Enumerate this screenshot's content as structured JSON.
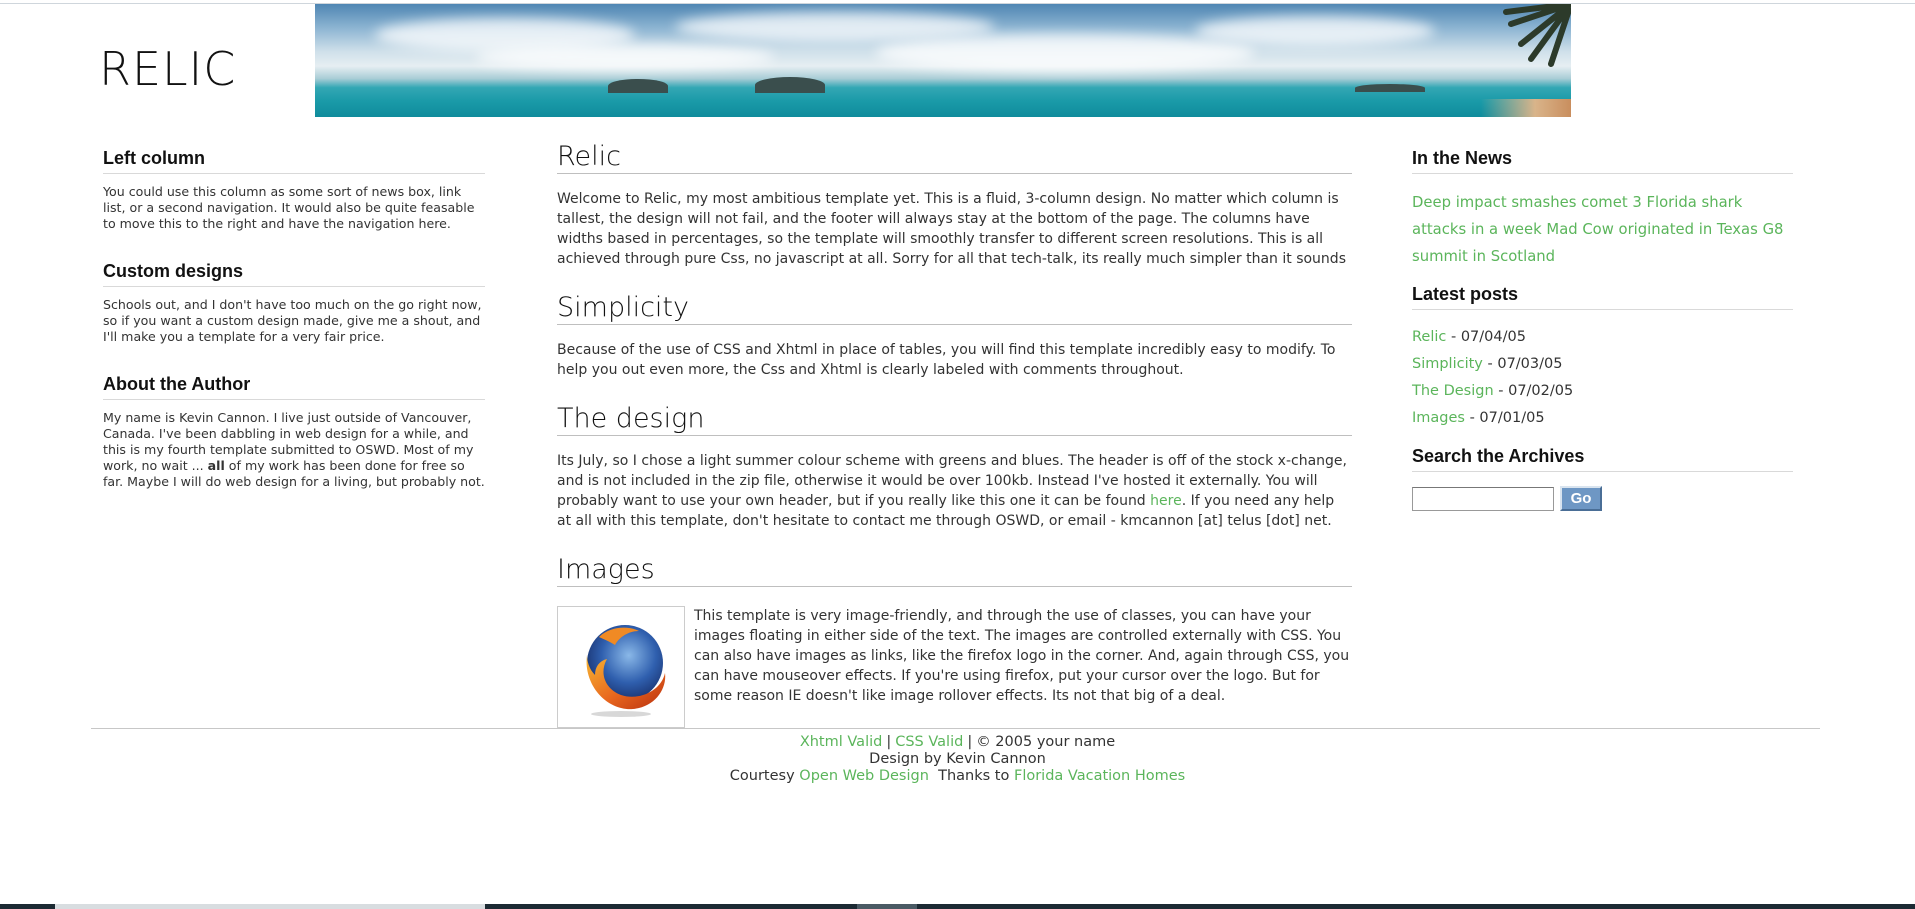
{
  "header": {
    "logo_text": "RELIC"
  },
  "left_column": [
    {
      "heading": "Left column",
      "text": "You could use this column as some sort of news box, link list, or a second navigation. It would also be quite feasable to move this to the right and have the navigation here."
    },
    {
      "heading": "Custom designs",
      "text": "Schools out, and I don't have too much on the go right now, so if you want a custom design made, give me a shout, and I'll make you a template for a very fair price."
    },
    {
      "heading": "About the Author",
      "text_before": "My name is Kevin Cannon. I live just outside of Vancouver, Canada. I've been dabbling in web design for a while, and this is my fourth template submitted to OSWD. Most of my work, no wait ... ",
      "text_bold": "all",
      "text_after": " of my work has been done for free so far. Maybe I will do web design for a living, but probably not."
    }
  ],
  "main": {
    "relic": {
      "heading": "Relic",
      "text": "Welcome to Relic, my most ambitious template yet. This is a fluid, 3-column design. No matter which column is tallest, the design will not fail, and the footer will always stay at the bottom of the page. The columns have widths based in percentages, so the template will smoothly transfer to different screen resolutions. This is all achieved through pure Css, no javascript at all. Sorry for all that tech-talk, its really much simpler than it sounds"
    },
    "simplicity": {
      "heading": "Simplicity",
      "text": "Because of the use of CSS and Xhtml in place of tables, you will find this template incredibly easy to modify. To help you out even more, the Css and Xhtml is clearly labeled with comments throughout."
    },
    "design": {
      "heading": "The design",
      "text_before": "Its July, so I chose a light summer colour scheme with greens and blues. The header is off of the stock x-change, and is not included in the zip file, otherwise it would be over 100kb. Instead I've hosted it externally. You will probably want to use your own header, but if you really like this one it can be found ",
      "link": "here",
      "text_after": ". If you need any help at all with this template, don't hesitate to contact me through OSWD, or email - kmcannon [at] telus [dot] net."
    },
    "images": {
      "heading": "Images",
      "text": "This template is very image-friendly, and through the use of classes, you can have your images floating in either side of the text. The images are controlled externally with CSS. You can also have images as links, like the firefox logo in the corner. And, again through CSS, you can have mouseover effects. If you're using firefox, put your cursor over the logo. But for some reason IE doesn't like image rollover effects. Its not that big of a deal."
    }
  },
  "right_column": {
    "news": {
      "heading": "In the News",
      "links": [
        "Deep impact smashes comet",
        "3 Florida shark attacks in a week",
        "Mad Cow originated in Texas",
        "G8 summit in Scotland"
      ]
    },
    "posts": {
      "heading": "Latest posts",
      "items": [
        {
          "label": "Relic",
          "date": " - 07/04/05"
        },
        {
          "label": "Simplicity",
          "date": " - 07/03/05"
        },
        {
          "label": "The Design",
          "date": " - 07/02/05"
        },
        {
          "label": "Images",
          "date": " - 07/01/05"
        }
      ]
    },
    "search": {
      "heading": "Search the Archives",
      "input_value": "",
      "button_label": "Go"
    }
  },
  "footer": {
    "xhtml_link": "Xhtml Valid",
    "css_link": "CSS Valid",
    "separator": "|",
    "copyright": "© 2005 your name",
    "design_by": "Design by Kevin Cannon",
    "courtesy_label": "Courtesy",
    "courtesy_link": "Open Web Design",
    "thanks_label": "Thanks to",
    "thanks_link": "Florida Vacation Homes"
  },
  "colors": {
    "link": "#5bb55b",
    "button": "#6e97c4",
    "text": "#333333"
  }
}
